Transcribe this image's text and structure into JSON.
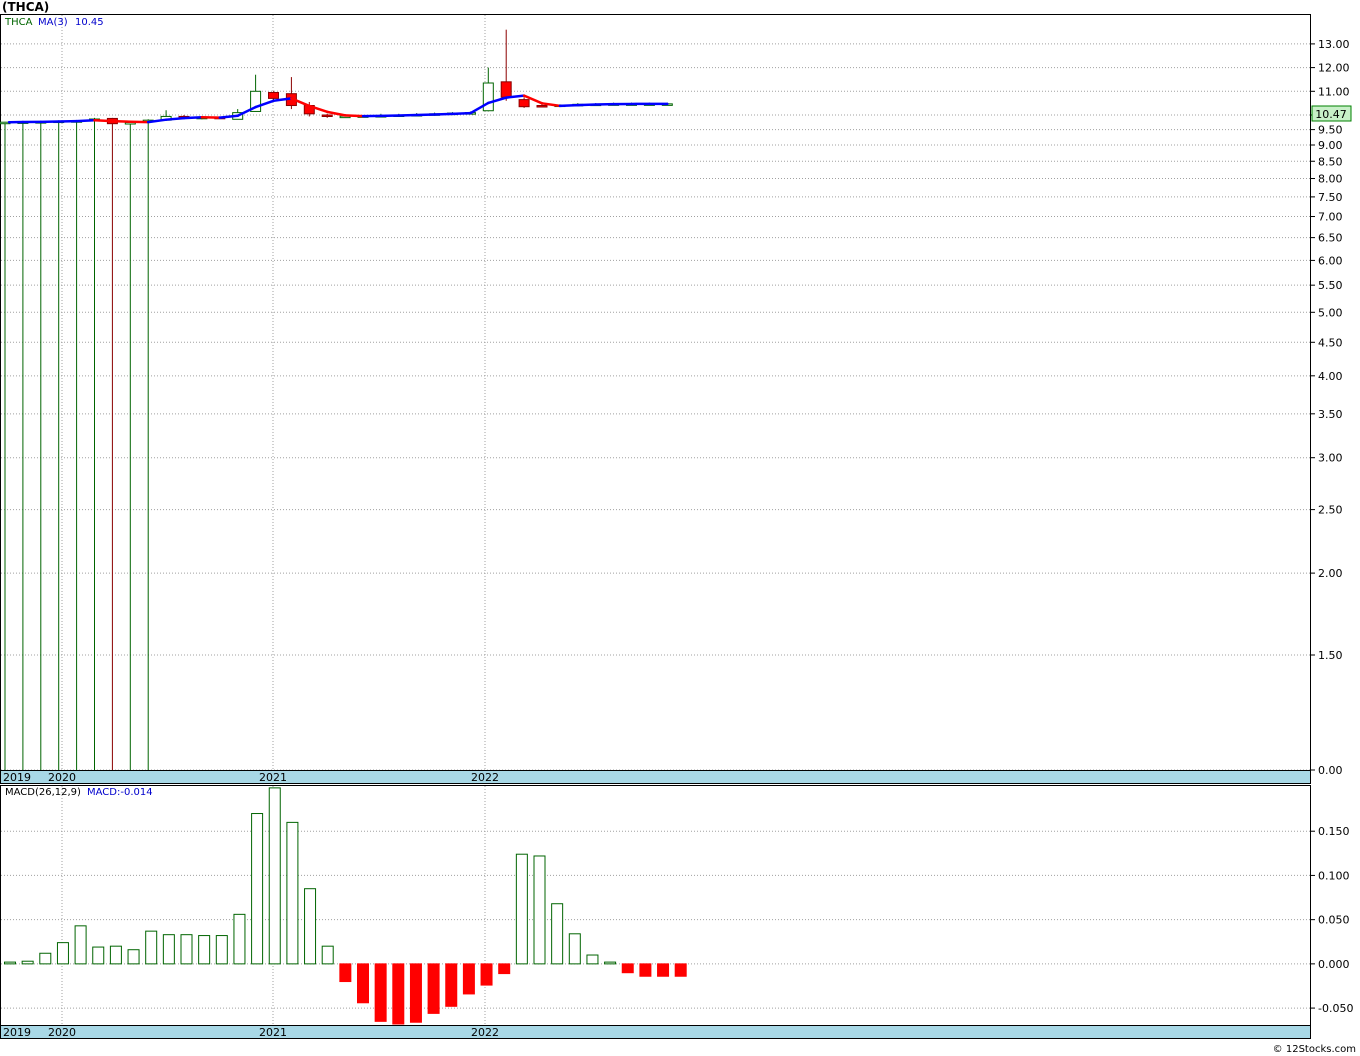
{
  "header": {
    "title": "(THCA)"
  },
  "footer": {
    "copyright": "© 12Stocks.com"
  },
  "chart_data": [
    {
      "type": "candlestick",
      "legend": {
        "symbol": "THCA",
        "ma_label": "MA(3)",
        "ma_value": "10.45"
      },
      "last_price_label": "10.47",
      "y_ticks": [
        "13.00",
        "12.00",
        "11.00",
        "10.00",
        "9.50",
        "9.00",
        "8.50",
        "8.00",
        "7.50",
        "7.00",
        "6.50",
        "6.00",
        "5.50",
        "5.00",
        "4.50",
        "4.00",
        "3.50",
        "3.00",
        "2.50",
        "2.00",
        "1.50",
        "0.00"
      ],
      "x_labels": [
        "2019",
        "2020",
        "2021",
        "2022"
      ],
      "ylim": [
        0,
        14
      ],
      "candles": [
        {
          "o": 9.74,
          "h": 9.76,
          "l": 0.0,
          "c": 9.75
        },
        {
          "o": 9.75,
          "h": 9.77,
          "l": 0.0,
          "c": 9.76
        },
        {
          "o": 9.76,
          "h": 9.78,
          "l": 0.0,
          "c": 9.77
        },
        {
          "o": 9.77,
          "h": 9.79,
          "l": 0.0,
          "c": 9.79
        },
        {
          "o": 9.79,
          "h": 9.81,
          "l": 0.0,
          "c": 9.8
        },
        {
          "o": 9.8,
          "h": 9.9,
          "l": 0.0,
          "c": 9.86
        },
        {
          "o": 9.88,
          "h": 9.9,
          "l": 0.0,
          "c": 9.7
        },
        {
          "o": 9.72,
          "h": 9.8,
          "l": 0.0,
          "c": 9.74
        },
        {
          "o": 9.8,
          "h": 9.85,
          "l": 0.0,
          "c": 9.82
        },
        {
          "o": 9.82,
          "h": 10.2,
          "l": 9.8,
          "c": 9.95
        },
        {
          "o": 9.95,
          "h": 10.0,
          "l": 9.88,
          "c": 9.9
        },
        {
          "o": 9.9,
          "h": 9.95,
          "l": 9.85,
          "c": 9.92
        },
        {
          "o": 9.92,
          "h": 9.95,
          "l": 9.88,
          "c": 9.9
        },
        {
          "o": 9.85,
          "h": 10.25,
          "l": 9.85,
          "c": 10.1
        },
        {
          "o": 10.15,
          "h": 11.7,
          "l": 10.15,
          "c": 11.0
        },
        {
          "o": 10.95,
          "h": 11.0,
          "l": 10.65,
          "c": 10.7
        },
        {
          "o": 10.9,
          "h": 11.6,
          "l": 10.25,
          "c": 10.4
        },
        {
          "o": 10.4,
          "h": 10.55,
          "l": 9.95,
          "c": 10.05
        },
        {
          "o": 10.0,
          "h": 10.05,
          "l": 9.9,
          "c": 9.95
        },
        {
          "o": 9.95,
          "h": 10.0,
          "l": 9.9,
          "c": 9.96
        },
        {
          "o": 9.96,
          "h": 10.0,
          "l": 9.92,
          "c": 9.97
        },
        {
          "o": 9.97,
          "h": 10.05,
          "l": 9.93,
          "c": 9.98
        },
        {
          "o": 9.98,
          "h": 10.05,
          "l": 9.95,
          "c": 10.0
        },
        {
          "o": 10.0,
          "h": 10.08,
          "l": 9.97,
          "c": 10.02
        },
        {
          "o": 10.02,
          "h": 10.1,
          "l": 9.98,
          "c": 10.05
        },
        {
          "o": 10.05,
          "h": 10.12,
          "l": 10.0,
          "c": 10.08
        },
        {
          "o": 10.08,
          "h": 10.15,
          "l": 10.02,
          "c": 10.1
        },
        {
          "o": 10.18,
          "h": 12.0,
          "l": 10.15,
          "c": 11.35
        },
        {
          "o": 11.4,
          "h": 13.6,
          "l": 10.6,
          "c": 10.75
        },
        {
          "o": 10.65,
          "h": 10.75,
          "l": 10.3,
          "c": 10.35
        },
        {
          "o": 10.4,
          "h": 10.45,
          "l": 10.32,
          "c": 10.38
        },
        {
          "o": 10.4,
          "h": 10.45,
          "l": 10.35,
          "c": 10.42
        },
        {
          "o": 10.42,
          "h": 10.5,
          "l": 10.38,
          "c": 10.45
        },
        {
          "o": 10.45,
          "h": 10.5,
          "l": 10.42,
          "c": 10.46
        },
        {
          "o": 10.46,
          "h": 10.52,
          "l": 10.43,
          "c": 10.47
        },
        {
          "o": 10.47,
          "h": 10.52,
          "l": 10.44,
          "c": 10.47
        },
        {
          "o": 10.47,
          "h": 10.52,
          "l": 10.44,
          "c": 10.47
        },
        {
          "o": 10.47,
          "h": 10.52,
          "l": 10.44,
          "c": 10.47
        }
      ],
      "colors": {
        "up": "#006400",
        "down": "#ff0000",
        "ma_up": "#0000ff",
        "ma_down": "#ff0000",
        "price_label_bg": "#c8f0c8",
        "axis_band": "#a8d8e6"
      }
    },
    {
      "type": "bar",
      "legend": {
        "label": "MACD(26,12,9)",
        "value_label": "MACD:-0.014"
      },
      "y_ticks": [
        "0.150",
        "0.100",
        "0.050",
        "0.000",
        "-0.050"
      ],
      "x_labels": [
        "2019",
        "2020",
        "2021",
        "2022"
      ],
      "ylim": [
        -0.068,
        0.2
      ],
      "values": [
        0.002,
        0.003,
        0.012,
        0.024,
        0.043,
        0.019,
        0.02,
        0.016,
        0.037,
        0.033,
        0.033,
        0.032,
        0.032,
        0.056,
        0.17,
        0.199,
        0.16,
        0.085,
        0.02,
        -0.02,
        -0.044,
        -0.065,
        -0.068,
        -0.066,
        -0.056,
        -0.048,
        -0.034,
        -0.024,
        -0.011,
        0.124,
        0.122,
        0.068,
        0.034,
        0.01,
        0.002,
        -0.01,
        -0.014,
        -0.014,
        -0.014
      ]
    }
  ]
}
